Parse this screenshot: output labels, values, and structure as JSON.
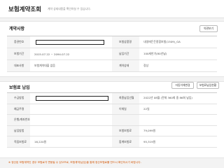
{
  "header": {
    "title": "보험계약조회",
    "subtitle": "계약 상세내용을 확인하실 수 있습니다."
  },
  "contract": {
    "section_title": "계약사항",
    "print_button": "약관보기",
    "rows": [
      {
        "l1": "증권번호",
        "v1": "",
        "l2": "보험상품명",
        "v2": "내생애든든종합보험(1509)_GA"
      },
      {
        "l1": "보험기간",
        "v1": "2015.07.22 ~ 2094.07.22",
        "l2": "납입기간",
        "v2": "100세만기(80년납)"
      },
      {
        "l1": "대표사항",
        "v1": "보험계약대출 없음",
        "l2": "계약상태",
        "v2": "정상"
      }
    ]
  },
  "payment": {
    "section_title": "보험료 납입",
    "change_payment_button": "자동이체변경",
    "pay_history_button": "보험료납입현황",
    "rows": [
      {
        "l1": "수금방법",
        "v1": "",
        "l2": "최종납입년월",
        "v2": "2022년 08월 (전체 360회 중 86회 납입)"
      },
      {
        "l1": "예금주명",
        "v1": "",
        "l2": "이체일",
        "v2": "22일"
      },
      {
        "l1": "은행/계좌번호",
        "v1": "",
        "l2": "",
        "v2": ""
      },
      {
        "l1": "납입방법",
        "v1": "",
        "l2": "보험보험료",
        "v2": "79,099원"
      },
      {
        "l1": "적립보험료",
        "v1": "16,220원",
        "l2": "합계보험료",
        "v2": "95,319원"
      }
    ]
  },
  "notice": "※ 정산된 보험계약인 경우 보험료가 변동될 수 있으므로, 보험계약(납입)을 통해 정산보험료를 반드시 확인하시기 바랍니다."
}
